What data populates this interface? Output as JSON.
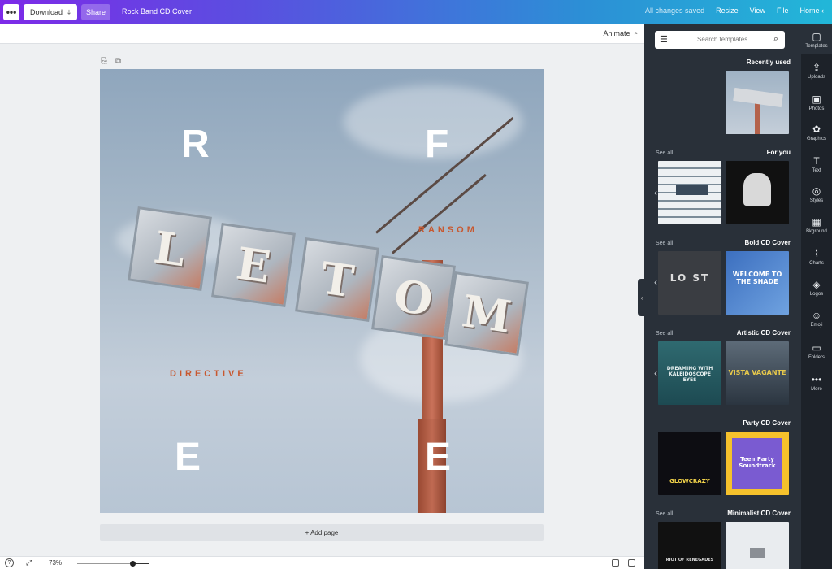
{
  "topbar": {
    "more_label": "•••",
    "download_label": "Download",
    "share_label": "Share",
    "title": "Rock Band CD Cover",
    "saved": "All changes saved",
    "nav": [
      "Resize",
      "View",
      "File",
      "Home"
    ],
    "home_arrow": "‹"
  },
  "toolbar": {
    "animate_label": "Animate"
  },
  "canvas": {
    "letters": [
      "R",
      "F",
      "E",
      "E"
    ],
    "sign_letters": [
      "L",
      "E",
      "T",
      "O",
      "M"
    ],
    "word_ransom": "RANSOM",
    "word_directive": "DIRECTIVE"
  },
  "add_page_label": "+ Add page",
  "bottombar": {
    "zoom": "73%",
    "help": "?"
  },
  "panel": {
    "search_placeholder": "Search templates",
    "sections": [
      {
        "title": "Recently used",
        "see_all": ""
      },
      {
        "title": "For you",
        "see_all": "See all"
      },
      {
        "title": "Bold CD Cover",
        "see_all": "See all"
      },
      {
        "title": "Artistic CD Cover",
        "see_all": "See all"
      },
      {
        "title": "Party CD Cover",
        "see_all": ""
      },
      {
        "title": "Minimalist CD Cover",
        "see_all": "See all"
      }
    ],
    "thumb_texts": {
      "bold_left": "LO ST",
      "bold_right": "WELCOME TO THE SHADE",
      "artistic_left": "DREAMING WITH KALEIDOSCOPE EYES",
      "artistic_right": "VISTA VAGANTE",
      "party_left": "GLOWCRAZY",
      "party_right": "Teen Party Soundtrack",
      "minimal_left": "RIOT OF RENEGADES"
    }
  },
  "rail": {
    "items": [
      {
        "label": "Templates",
        "icon": "▢"
      },
      {
        "label": "Uploads",
        "icon": "⇪"
      },
      {
        "label": "Photos",
        "icon": "▣"
      },
      {
        "label": "Graphics",
        "icon": "✿"
      },
      {
        "label": "Text",
        "icon": "T"
      },
      {
        "label": "Styles",
        "icon": "◎"
      },
      {
        "label": "Bkground",
        "icon": "▦"
      },
      {
        "label": "Charts",
        "icon": "⌇"
      },
      {
        "label": "Logos",
        "icon": "◈"
      },
      {
        "label": "Emoji",
        "icon": "☺"
      },
      {
        "label": "Folders",
        "icon": "▭"
      },
      {
        "label": "More",
        "icon": "•••"
      }
    ]
  },
  "colors": {
    "accent_start": "#7d2ae8",
    "accent_end": "#22b7d8",
    "panel": "#293039",
    "rail": "#1d2229"
  }
}
